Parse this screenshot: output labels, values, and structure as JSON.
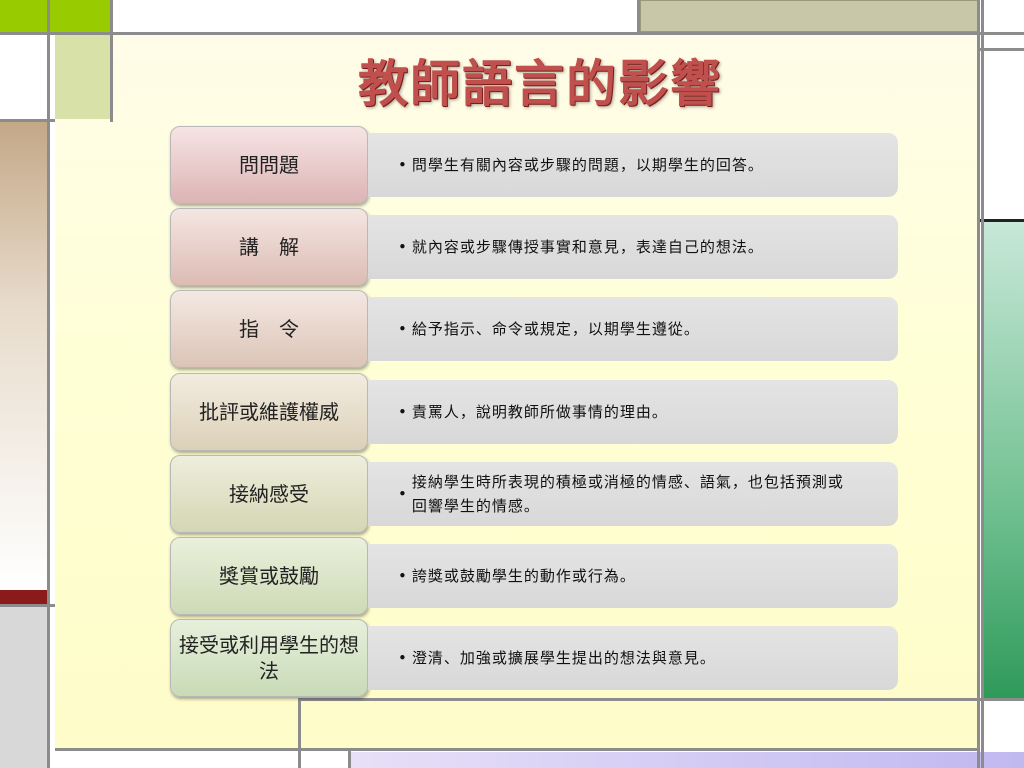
{
  "title": "教師語言的影響",
  "rows": [
    {
      "label": "問問題",
      "bullet": "•",
      "desc": "問學生有關內容或步驟的問題，以期學生的回答。"
    },
    {
      "label": "講　解",
      "bullet": "•",
      "desc": "就內容或步驟傳授事實和意見，表達自己的想法。"
    },
    {
      "label": "指　令",
      "bullet": "•",
      "desc": "給予指示、命令或規定，以期學生遵從。"
    },
    {
      "label": "批評或維護權威",
      "bullet": "•",
      "desc": "責罵人，說明教師所做事情的理由。"
    },
    {
      "label": "接納感受",
      "bullet": "•",
      "desc": "接納學生時所表現的積極或消極的情感、語氣，也包括預測或回響學生的情感。"
    },
    {
      "label": "獎賞或鼓勵",
      "bullet": "•",
      "desc": "誇獎或鼓勵學生的動作或行為。"
    },
    {
      "label": "接受或利用學生的想法",
      "bullet": "•",
      "desc": "澄清、加強或擴展學生提出的想法與意見。"
    }
  ]
}
